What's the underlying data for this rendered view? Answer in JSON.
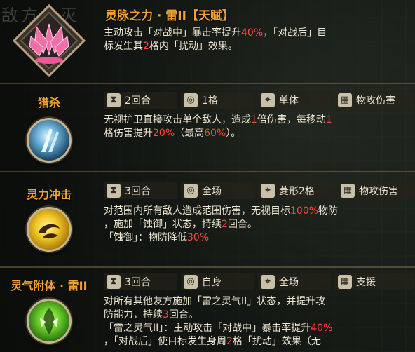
{
  "background_word": "敌方全灭",
  "talent": {
    "title": "灵脉之力 · 雷II",
    "tag": "【天赋】",
    "desc_lines": [
      [
        "主动攻击「对战中」暴击率提升",
        "40%",
        "，「对战后」目"
      ],
      [
        "标发生其",
        "2",
        "格内「扰动」效果。"
      ]
    ]
  },
  "skills": [
    {
      "name": "猎杀",
      "attrs": [
        {
          "icon": "hourglass-icon",
          "text": "2回合"
        },
        {
          "icon": "range-icon",
          "text": "1格"
        },
        {
          "icon": "target-icon",
          "text": "单体"
        },
        {
          "icon": "grid-icon",
          "text": "物攻伤害"
        }
      ],
      "desc_lines": [
        [
          "无视护卫直接攻击单个敌人，造成",
          "1",
          "倍伤害，每移动",
          "1",
          ""
        ],
        [
          "格伤害提升",
          "20%",
          "（最高",
          "60%",
          "）。"
        ]
      ]
    },
    {
      "name": "灵力冲击",
      "attrs": [
        {
          "icon": "hourglass-icon",
          "text": "3回合"
        },
        {
          "icon": "range-icon",
          "text": "全场"
        },
        {
          "icon": "target-icon",
          "text": "菱形2格"
        },
        {
          "icon": "grid-icon",
          "text": "物攻伤害"
        }
      ],
      "desc_lines": [
        [
          "对范围内所有敌人造成范围伤害，无视目标",
          "100%",
          "物防"
        ],
        [
          "，施加「蚀御」状态，持续",
          "2",
          "回合。"
        ],
        [
          "「蚀御」：物防降低",
          "30%",
          ""
        ]
      ]
    },
    {
      "name": "灵气附体 · 雷II",
      "attrs": [
        {
          "icon": "hourglass-icon",
          "text": "3回合"
        },
        {
          "icon": "range-icon",
          "text": "自身"
        },
        {
          "icon": "target-icon",
          "text": "全场"
        },
        {
          "icon": "grid-icon",
          "text": "支援"
        }
      ],
      "desc_lines": [
        [
          "对所有其他友方施加「雷之灵气II」状态，并提升攻"
        ],
        [
          "防能力，持续",
          "3",
          "回合。"
        ],
        [
          "「雷之灵气II」：主动攻击「对战中」暴击率提升",
          "40%",
          ""
        ],
        [
          "，「对战后」使目标发生身周",
          "2",
          "格「扰动」效果（无"
        ]
      ]
    }
  ],
  "colors": {
    "title": "#f0a232",
    "highlight": "#ff4a3a",
    "text": "#efe6d2"
  }
}
